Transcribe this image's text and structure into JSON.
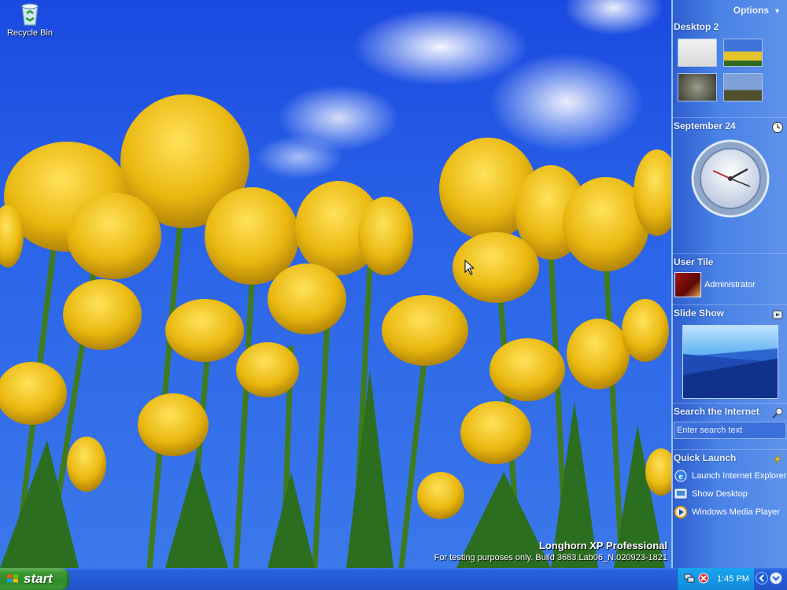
{
  "desktop": {
    "icons": [
      {
        "label": "Recycle Bin",
        "icon": "recycle-bin-icon"
      }
    ],
    "watermark": {
      "title": "Longhorn XP Professional",
      "subtitle": "For testing purposes only. Build 3683.Lab06_N.020923-1821"
    }
  },
  "sidebar": {
    "options_label": "Options",
    "desktop_tile": {
      "title": "Desktop 2"
    },
    "clock_tile": {
      "title": "September 24"
    },
    "user_tile": {
      "title": "User Tile",
      "user_name": "Administrator"
    },
    "slideshow_tile": {
      "title": "Slide Show"
    },
    "search_tile": {
      "title": "Search the Internet",
      "placeholder": "Enter search text"
    },
    "quick_launch": {
      "title": "Quick Launch",
      "items": [
        {
          "label": "Launch Internet Explorer",
          "icon": "internet-explorer-icon"
        },
        {
          "label": "Show Desktop",
          "icon": "show-desktop-icon"
        },
        {
          "label": "Windows Media Player",
          "icon": "media-player-icon"
        }
      ]
    }
  },
  "taskbar": {
    "start_label": "start",
    "clock": "1:45 PM"
  },
  "colors": {
    "sidebar": "#4a82e6",
    "taskbar": "#255bd6",
    "start": "#3c9a33",
    "tray": "#0f8ad8"
  }
}
